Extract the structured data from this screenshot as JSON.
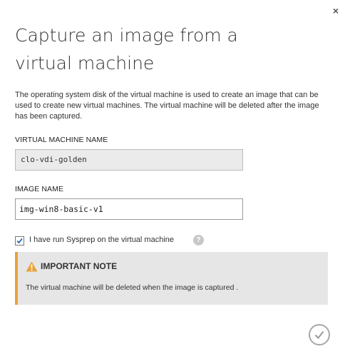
{
  "dialog": {
    "title": "Capture an image from a virtual machine",
    "description": "The operating system disk of the virtual machine is used to create an image that can be used to create new virtual machines. The virtual machine will be deleted after the image has been captured.",
    "close_icon": "close-icon",
    "close_glyph": "×"
  },
  "vm_name": {
    "label": "VIRTUAL MACHINE NAME",
    "value": "clo-vdi-golden"
  },
  "image_name": {
    "label": "IMAGE NAME",
    "value": "img-win8-basic-v1"
  },
  "sysprep": {
    "label": "I have run Sysprep on the virtual machine",
    "checked": true,
    "help_glyph": "?"
  },
  "note": {
    "title": "IMPORTANT NOTE",
    "text": "The virtual machine will be deleted when the image is captured .",
    "icon": "warning-icon"
  },
  "submit": {
    "icon": "checkmark-icon"
  },
  "colors": {
    "note_accent": "#e8a23a",
    "note_background": "#e6e6e6",
    "readonly_field_background": "#ebebeb",
    "checkmark": "#2a6ebb"
  }
}
